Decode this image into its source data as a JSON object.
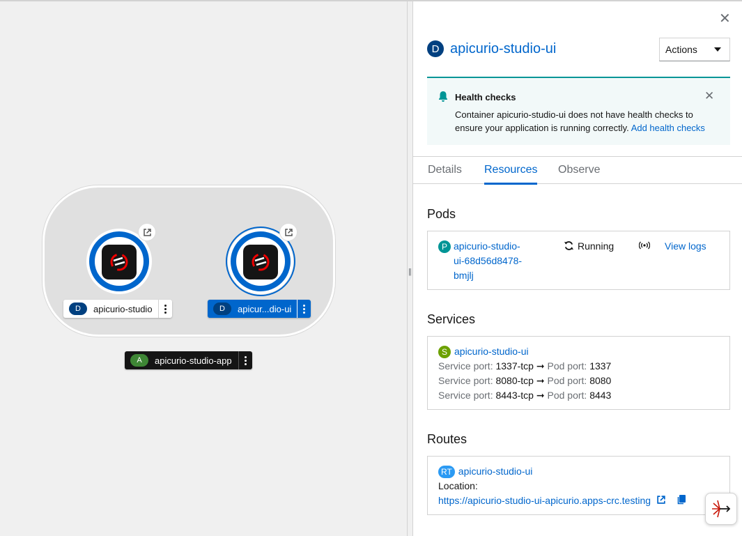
{
  "topology": {
    "nodes": [
      {
        "badge": "D",
        "label": "apicurio-studio",
        "selected": false
      },
      {
        "badge": "D",
        "label": "apicur...dio-ui",
        "selected": true
      }
    ],
    "application": {
      "badge": "A",
      "label": "apicurio-studio-app"
    }
  },
  "panel": {
    "title_badge": "D",
    "title": "apicurio-studio-ui",
    "actions_label": "Actions",
    "alert": {
      "heading": "Health checks",
      "body": "Container apicurio-studio-ui does not have health checks to ensure your application is running correctly.",
      "link": "Add health checks"
    },
    "tabs": [
      "Details",
      "Resources",
      "Observe"
    ],
    "active_tab": "Resources",
    "pods": {
      "heading": "Pods",
      "badge": "P",
      "name_lines": [
        "apicurio-studio-",
        "ui-68d56d8478-",
        "bmjlj"
      ],
      "status": "Running",
      "view_logs": "View logs"
    },
    "services": {
      "heading": "Services",
      "badge": "S",
      "name": "apicurio-studio-ui",
      "ports": [
        {
          "service_label": "Service port:",
          "service": "1337-tcp",
          "pod_label": "Pod port:",
          "pod": "1337"
        },
        {
          "service_label": "Service port:",
          "service": "8080-tcp",
          "pod_label": "Pod port:",
          "pod": "8080"
        },
        {
          "service_label": "Service port:",
          "service": "8443-tcp",
          "pod_label": "Pod port:",
          "pod": "8443"
        }
      ]
    },
    "routes": {
      "heading": "Routes",
      "badge": "RT",
      "name": "apicurio-studio-ui",
      "location_label": "Location:",
      "url": "https://apicurio-studio-ui-apicurio.apps-crc.testing"
    }
  },
  "colors": {
    "accent": "#0066cc",
    "deployment_badge": "#004080",
    "app_badge": "#3e8635",
    "pod_badge": "#009596",
    "service_badge": "#6ca100",
    "route_badge": "#2b9af3",
    "alert_border": "#009596"
  },
  "icons": [
    "external-link-icon",
    "kebab-icon",
    "close-icon",
    "bell-icon",
    "caret-down-icon",
    "sync-icon",
    "broadcast-icon",
    "copy-icon",
    "arrow-right-icon",
    "resize-handle-icon"
  ]
}
